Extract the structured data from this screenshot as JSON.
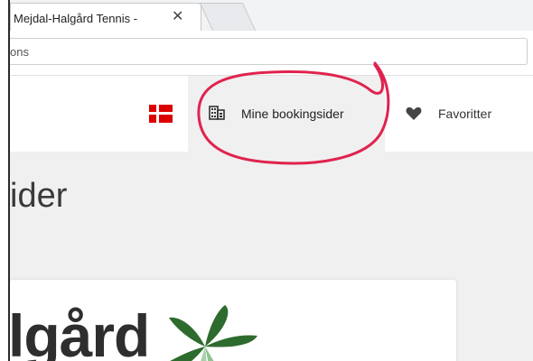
{
  "browser": {
    "tab_title": "Mejdal-Halgård Tennis -",
    "tab_close": "✕",
    "address_fragment": "ons"
  },
  "header": {
    "language_flag": "danish-flag",
    "nav": {
      "bookings_label": "Mine bookingsider",
      "bookings_icon": "building-icon",
      "favorites_label": "Favoritter",
      "favorites_icon": "heart-icon"
    }
  },
  "main": {
    "page_title_fragment": "ider",
    "logo_text_fragment": "lgård"
  },
  "colors": {
    "flag_red": "#dd0000",
    "annotation_red": "#e0234e",
    "nav_highlight": "#f0f0f0",
    "content_bg": "#f0f0f0",
    "logo_green_dark": "#2e6b2e",
    "logo_green_light": "#8fc28f"
  }
}
